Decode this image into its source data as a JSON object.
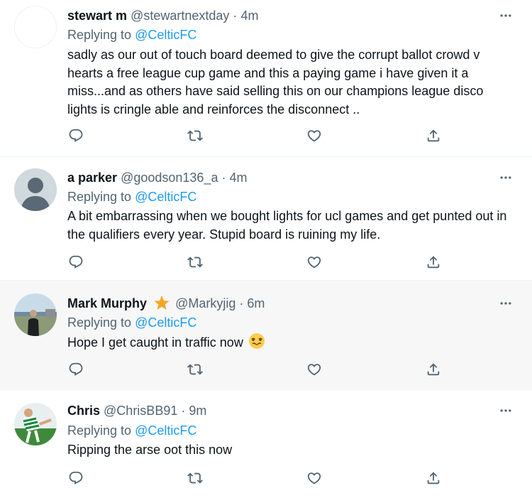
{
  "tweets": [
    {
      "name": "stewart m",
      "handle": "@stewartnextday",
      "separator": "·",
      "time": "4m",
      "replying_prefix": "Replying to",
      "replying_to": "@CelticFC",
      "text": "sadly as our out of touch board deemed to give the corrupt ballot crowd v hearts a free league cup game and this a paying game i have given it a miss...and as others have said selling this on our champions league disco lights is cringle able and reinforces the disconnect  .."
    },
    {
      "name": "a parker",
      "handle": "@goodson136_a",
      "separator": "·",
      "time": "4m",
      "replying_prefix": "Replying to",
      "replying_to": "@CelticFC",
      "text": "A bit embarrassing when we bought lights for ucl games and get punted out in the qualifiers every year. Stupid board is ruining my life."
    },
    {
      "name": "Mark Murphy",
      "handle": "@Markyjig",
      "separator": "·",
      "time": "6m",
      "replying_prefix": "Replying to",
      "replying_to": "@CelticFC",
      "text": "Hope I get caught in traffic now",
      "badge_icon": "star-emoji-icon",
      "emoji_icon": "woozy-face-emoji-icon"
    },
    {
      "name": "Chris",
      "handle": "@ChrisBB91",
      "separator": "·",
      "time": "9m",
      "replying_prefix": "Replying to",
      "replying_to": "@CelticFC",
      "text": "Ripping the arse oot this now"
    }
  ],
  "action_icons": [
    "reply-icon",
    "retweet-icon",
    "like-icon",
    "share-icon"
  ],
  "colors": {
    "link": "#1d9bf0",
    "secondary_text": "#536471",
    "primary_text": "#0f1419",
    "highlight_bg": "#f7f7f7",
    "divider": "#eff3f4"
  }
}
